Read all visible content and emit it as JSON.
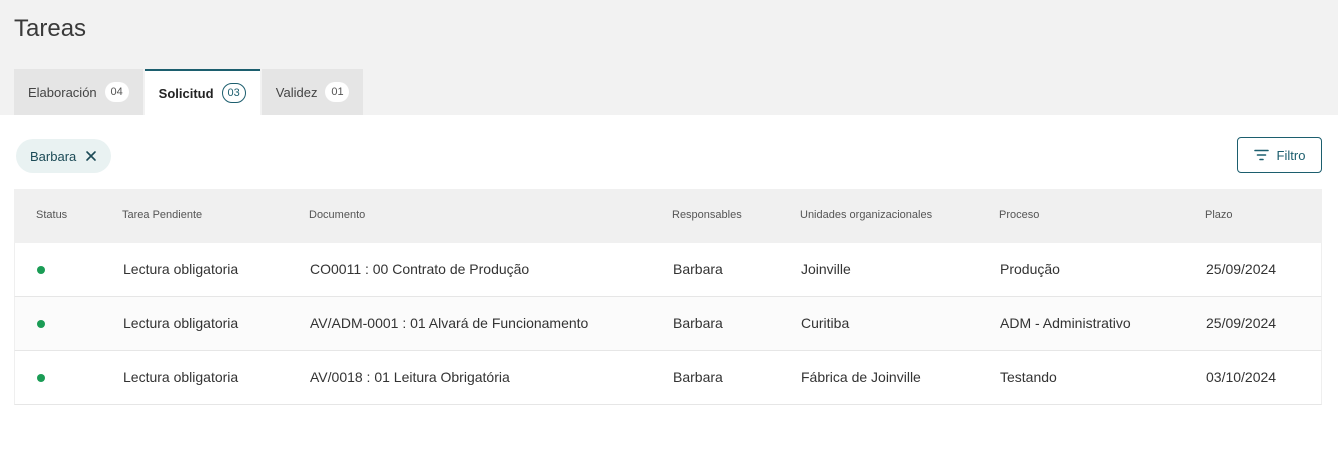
{
  "page": {
    "title": "Tareas"
  },
  "tabs": [
    {
      "label": "Elaboración",
      "count": "04",
      "active": false
    },
    {
      "label": "Solicitud",
      "count": "03",
      "active": true
    },
    {
      "label": "Validez",
      "count": "01",
      "active": false
    }
  ],
  "filter_chip": {
    "label": "Barbara",
    "icon": "close-icon"
  },
  "filter_button": {
    "label": "Filtro",
    "icon": "filter-icon"
  },
  "colors": {
    "accent": "#1c5e6e",
    "status_ok": "#1a9c55"
  },
  "table": {
    "headers": [
      "Status",
      "Tarea Pendiente",
      "Documento",
      "Responsables",
      "Unidades organizacionales",
      "Proceso",
      "Plazo"
    ],
    "rows": [
      {
        "status": "green",
        "task": "Lectura obligatoria",
        "document": "CO0011 : 00 Contrato de Produção",
        "responsible": "Barbara",
        "unit": "Joinville",
        "process": "Produção",
        "deadline": "25/09/2024"
      },
      {
        "status": "green",
        "task": "Lectura obligatoria",
        "document": "AV/ADM-0001 : 01 Alvará de Funcionamento",
        "responsible": "Barbara",
        "unit": "Curitiba",
        "process": "ADM - Administrativo",
        "deadline": "25/09/2024"
      },
      {
        "status": "green",
        "task": "Lectura obligatoria",
        "document": "AV/0018 : 01 Leitura Obrigatória",
        "responsible": "Barbara",
        "unit": "Fábrica de Joinville",
        "process": "Testando",
        "deadline": "03/10/2024"
      }
    ]
  }
}
